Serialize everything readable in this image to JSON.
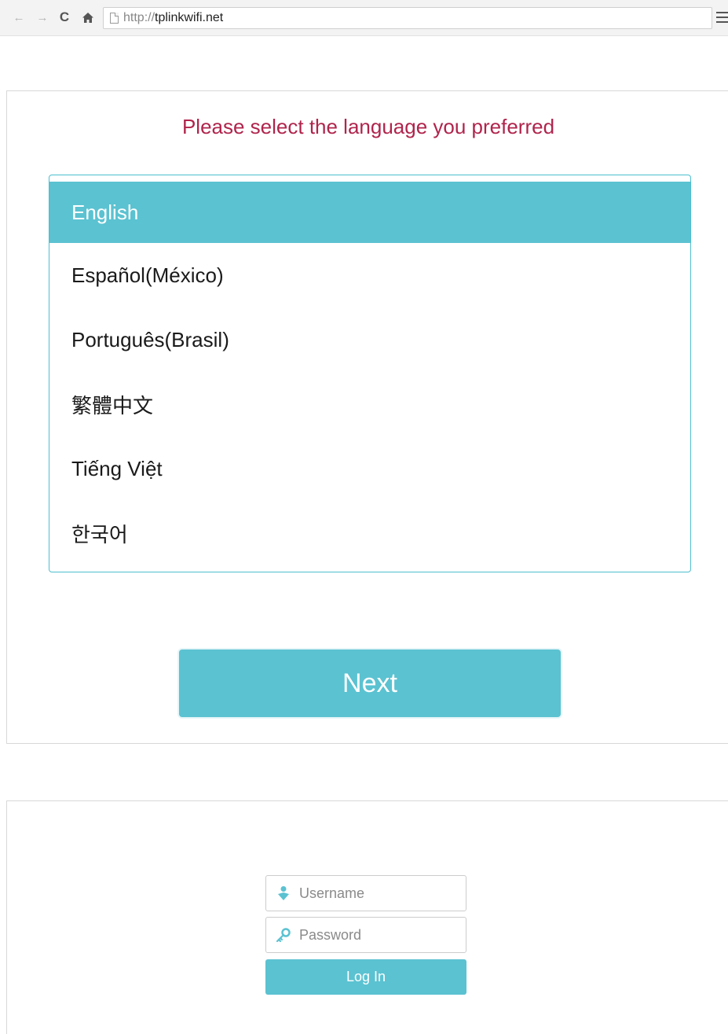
{
  "browser": {
    "url_scheme": "http://",
    "url_host": "tplinkwifi.net",
    "icons": [
      "back-arrow-icon",
      "forward-arrow-icon",
      "reload-icon",
      "home-icon",
      "page-icon",
      "menu-icon"
    ]
  },
  "language_panel": {
    "title": "Please select the language you preferred",
    "languages": [
      {
        "label": "English",
        "selected": true
      },
      {
        "label": "Español(México)",
        "selected": false
      },
      {
        "label": "Português(Brasil)",
        "selected": false
      },
      {
        "label": "繁體中文",
        "selected": false
      },
      {
        "label": "Tiếng Việt",
        "selected": false
      },
      {
        "label": "한국어",
        "selected": false
      }
    ],
    "next_label": "Next"
  },
  "login_panel": {
    "username_placeholder": "Username",
    "password_placeholder": "Password",
    "login_label": "Log In",
    "icons": [
      "user-icon",
      "key-icon"
    ]
  },
  "colors": {
    "accent": "#5bc2d1",
    "title": "#b0244c",
    "list_border": "#4dbfcf"
  }
}
